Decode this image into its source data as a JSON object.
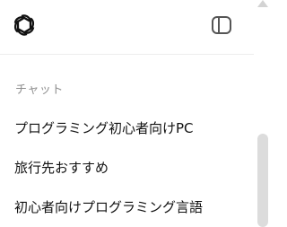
{
  "header": {
    "logo_icon": "openai-logo-icon",
    "toggle_icon": "sidebar-toggle-icon"
  },
  "section": {
    "label": "チャット"
  },
  "chats": [
    {
      "label": "プログラミング初心者向けPC"
    },
    {
      "label": "旅行先おすすめ"
    },
    {
      "label": "初心者向けプログラミング言語"
    }
  ],
  "colors": {
    "background": "#ffffff",
    "text": "#111111",
    "muted": "#8e8e8e",
    "divider": "#ececec",
    "scrollbar": "#dcdcdc"
  }
}
